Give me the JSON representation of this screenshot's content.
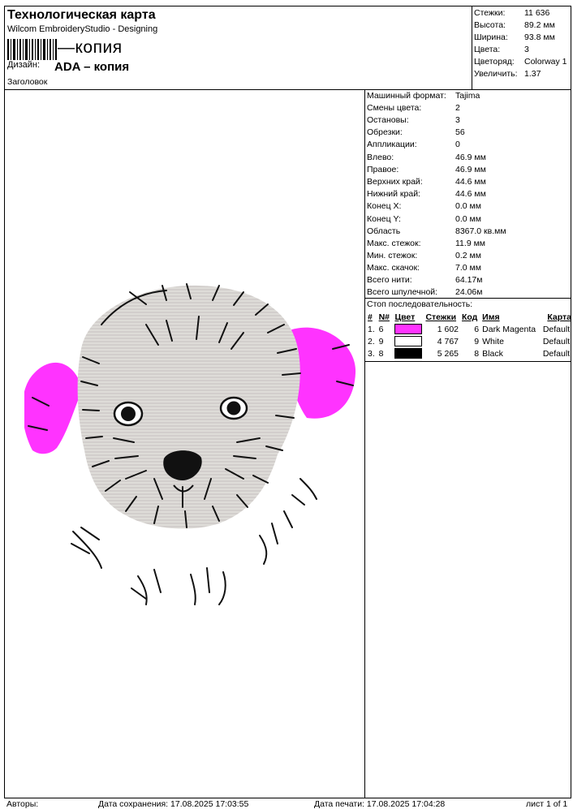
{
  "header": {
    "title": "Технологическая карта",
    "software": "Wilcom EmbroideryStudio - Designing",
    "barcode_text": "—копия",
    "design_label": "Дизайн:",
    "design_value": "ADA – копия",
    "heading_label": "Заголовок"
  },
  "summary": [
    {
      "label": "Стежки:",
      "value": "11 636"
    },
    {
      "label": "Высота:",
      "value": "89.2 мм"
    },
    {
      "label": "Ширина:",
      "value": "93.8 мм"
    },
    {
      "label": "Цвета:",
      "value": "3"
    },
    {
      "label": "Цветоряд:",
      "value": "Colorway 1"
    },
    {
      "label": "Увеличить:",
      "value": "1.37"
    }
  ],
  "machine": [
    {
      "label": "Машинный формат:",
      "value": "Tajima"
    },
    {
      "label": "Смены цвета:",
      "value": "2"
    },
    {
      "label": "Остановы:",
      "value": "3"
    },
    {
      "label": "Обрезки:",
      "value": "56"
    },
    {
      "label": "Аппликации:",
      "value": "0"
    },
    {
      "label": "Влево:",
      "value": "46.9 мм"
    },
    {
      "label": "Правое:",
      "value": "46.9 мм"
    },
    {
      "label": "Верхних край:",
      "value": "44.6 мм"
    },
    {
      "label": "Нижний край:",
      "value": "44.6 мм"
    },
    {
      "label": "Конец X:",
      "value": "0.0 мм"
    },
    {
      "label": "Конец Y:",
      "value": "0.0 мм"
    },
    {
      "label": "Область",
      "value": "8367.0 кв.мм"
    },
    {
      "label": "Макс. стежок:",
      "value": "11.9 мм"
    },
    {
      "label": "Мин. стежок:",
      "value": "0.2 мм"
    },
    {
      "label": "Макс. скачок:",
      "value": "7.0 мм"
    },
    {
      "label": "Всего нити:",
      "value": "64.17м"
    },
    {
      "label": "Всего шпулечной:",
      "value": "24.06м"
    }
  ],
  "sequence": {
    "title": "Стоп последовательность:",
    "headers": [
      "#",
      "N#",
      "Цвет",
      "Стежки",
      "Код",
      "Имя",
      "Карта"
    ],
    "rows": [
      {
        "idx": "1.",
        "n": "6",
        "color": "#ff33ff",
        "stitches": "1 602",
        "code": "6",
        "name": "Dark Magenta",
        "chart": "Default"
      },
      {
        "idx": "2.",
        "n": "9",
        "color": "#ffffff",
        "stitches": "4 767",
        "code": "9",
        "name": "White",
        "chart": "Default"
      },
      {
        "idx": "3.",
        "n": "8",
        "color": "#000000",
        "stitches": "5 265",
        "code": "8",
        "name": "Black",
        "chart": "Default"
      }
    ]
  },
  "footer": {
    "authors": "Авторы:",
    "saved": "Дата сохранения: 17.08.2025 17:03:55",
    "printed": "Дата печати: 17.08.2025 17:04:28",
    "page": "лист 1 of 1"
  },
  "colors": {
    "magenta": "#ff33ff",
    "fur": "#d9d6d3",
    "line": "#111111"
  }
}
